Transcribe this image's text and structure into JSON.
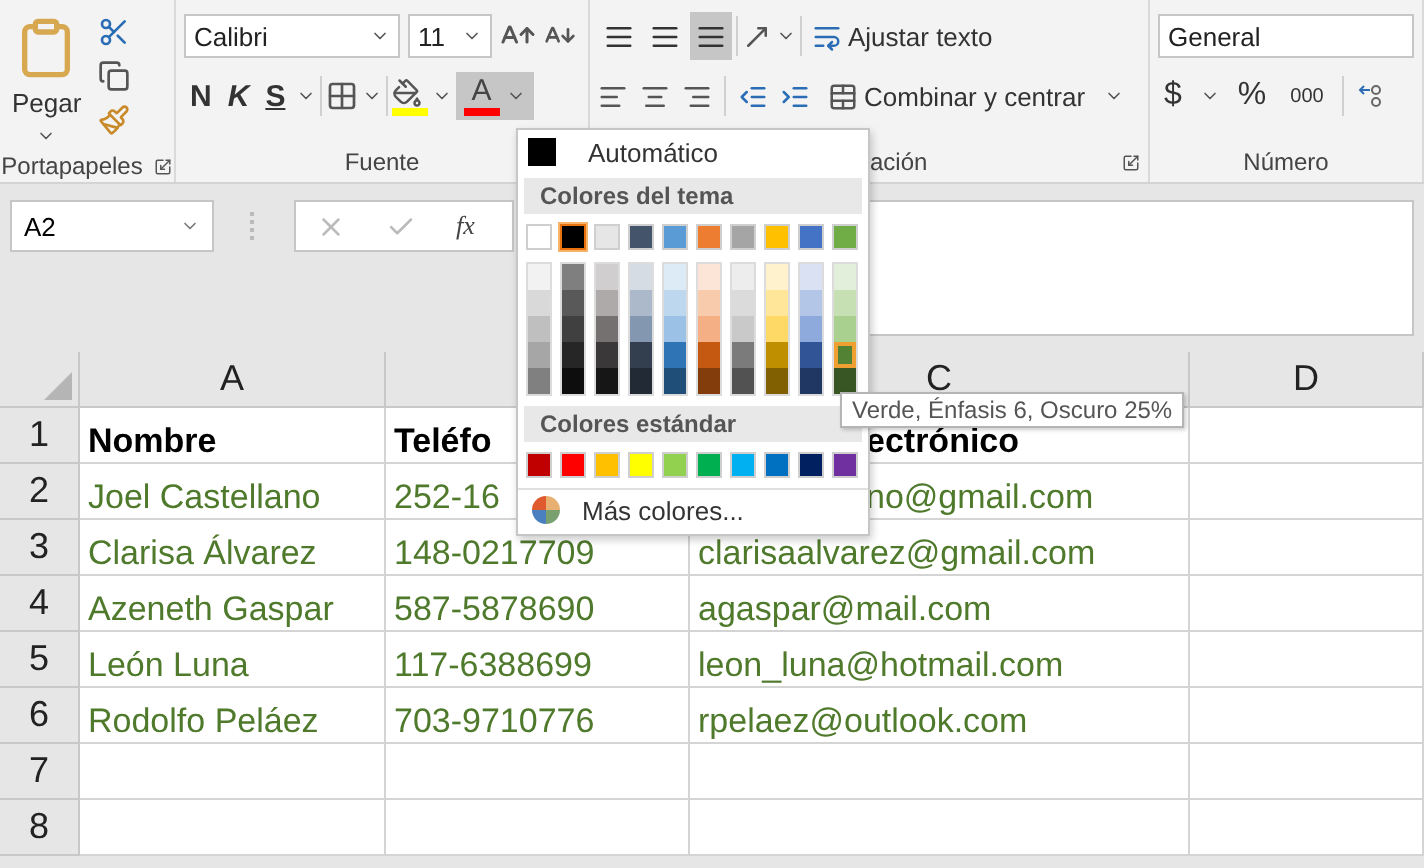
{
  "ribbon": {
    "clipboard": {
      "paste": "Pegar",
      "label": "Portapapeles"
    },
    "font": {
      "name": "Calibri",
      "size": "11",
      "bold": "N",
      "italic": "K",
      "underline": "S",
      "font_color_letter": "A",
      "font_color_open": true,
      "label": "Fuente"
    },
    "alignment": {
      "vertical_align": [
        {
          "selected": false
        },
        {
          "selected": false
        },
        {
          "selected": true
        }
      ],
      "wrap": "Ajustar texto",
      "merge": "Combinar y centrar",
      "label": "ación"
    },
    "number": {
      "format": "General",
      "currency": "$",
      "percent": "%",
      "thousands": "000",
      "label": "Número"
    }
  },
  "formula_bar": {
    "name_box": "A2",
    "function_label": "fx"
  },
  "sheet": {
    "columns": [
      {
        "label": "A"
      },
      {},
      {
        "label": "C"
      },
      {
        "label": "D"
      }
    ],
    "rows": [
      {
        "number": "1",
        "kind": "header",
        "cells": [
          {
            "text": "Nombre"
          },
          {
            "text": "Teléfo"
          },
          {
            "text": "ectrónico",
            "clipped": true
          },
          {}
        ]
      },
      {
        "number": "2",
        "kind": "data",
        "cells": [
          {
            "text": "Joel Castellano"
          },
          {
            "text": "252-16"
          },
          {
            "text": "no@gmail.com",
            "clipped": true
          },
          {}
        ]
      },
      {
        "number": "3",
        "kind": "data",
        "cells": [
          {
            "text": "Clarisa Álvarez"
          },
          {
            "text": "148-0217709"
          },
          {
            "text": "clarisaalvarez@gmail.com"
          },
          {}
        ]
      },
      {
        "number": "4",
        "kind": "data",
        "cells": [
          {
            "text": "Azeneth Gaspar"
          },
          {
            "text": "587-5878690"
          },
          {
            "text": "agaspar@mail.com"
          },
          {}
        ]
      },
      {
        "number": "5",
        "kind": "data",
        "cells": [
          {
            "text": "León Luna"
          },
          {
            "text": "117-6388699"
          },
          {
            "text": "leon_luna@hotmail.com"
          },
          {}
        ]
      },
      {
        "number": "6",
        "kind": "data",
        "cells": [
          {
            "text": "Rodolfo Peláez"
          },
          {
            "text": "703-9710776"
          },
          {
            "text": "rpelaez@outlook.com"
          },
          {}
        ]
      },
      {
        "number": "7",
        "kind": "data",
        "cells": [
          {},
          {},
          {},
          {}
        ]
      },
      {
        "number": "8",
        "kind": "data",
        "cells": [
          {},
          {},
          {},
          {}
        ]
      }
    ]
  },
  "color_menu": {
    "automatic": "Automático",
    "theme_title": "Colores del tema",
    "theme_colors": [
      {
        "color": "#ffffff",
        "selected": false,
        "shades": [
          {
            "color": "#f2f2f2",
            "selected": false
          },
          {
            "color": "#d9d9d9",
            "selected": false
          },
          {
            "color": "#bfbfbf",
            "selected": false
          },
          {
            "color": "#a6a6a6",
            "selected": false
          },
          {
            "color": "#808080",
            "selected": false
          }
        ]
      },
      {
        "color": "#000000",
        "selected": true,
        "shades": [
          {
            "color": "#7f7f7f",
            "selected": false
          },
          {
            "color": "#595959",
            "selected": false
          },
          {
            "color": "#404040",
            "selected": false
          },
          {
            "color": "#262626",
            "selected": false
          },
          {
            "color": "#0d0d0d",
            "selected": false
          }
        ]
      },
      {
        "color": "#e7e6e6",
        "selected": false,
        "shades": [
          {
            "color": "#d0cece",
            "selected": false
          },
          {
            "color": "#aeaaaa",
            "selected": false
          },
          {
            "color": "#757171",
            "selected": false
          },
          {
            "color": "#3a3838",
            "selected": false
          },
          {
            "color": "#171616",
            "selected": false
          }
        ]
      },
      {
        "color": "#44546a",
        "selected": false,
        "shades": [
          {
            "color": "#d6dce4",
            "selected": false
          },
          {
            "color": "#acb9ca",
            "selected": false
          },
          {
            "color": "#8497b0",
            "selected": false
          },
          {
            "color": "#333f4f",
            "selected": false
          },
          {
            "color": "#222b35",
            "selected": false
          }
        ]
      },
      {
        "color": "#5b9bd5",
        "selected": false,
        "shades": [
          {
            "color": "#ddebf7",
            "selected": false
          },
          {
            "color": "#bdd7ee",
            "selected": false
          },
          {
            "color": "#9bc2e6",
            "selected": false
          },
          {
            "color": "#2f75b5",
            "selected": false
          },
          {
            "color": "#1f4e78",
            "selected": false
          }
        ]
      },
      {
        "color": "#ed7d31",
        "selected": false,
        "shades": [
          {
            "color": "#fce4d6",
            "selected": false
          },
          {
            "color": "#f8cbad",
            "selected": false
          },
          {
            "color": "#f4b084",
            "selected": false
          },
          {
            "color": "#c65911",
            "selected": false
          },
          {
            "color": "#833c0c",
            "selected": false
          }
        ]
      },
      {
        "color": "#a5a5a5",
        "selected": false,
        "shades": [
          {
            "color": "#ededed",
            "selected": false
          },
          {
            "color": "#dbdbdb",
            "selected": false
          },
          {
            "color": "#c9c9c9",
            "selected": false
          },
          {
            "color": "#7b7b7b",
            "selected": false
          },
          {
            "color": "#525252",
            "selected": false
          }
        ]
      },
      {
        "color": "#ffc000",
        "selected": false,
        "shades": [
          {
            "color": "#fff2cc",
            "selected": false
          },
          {
            "color": "#ffe699",
            "selected": false
          },
          {
            "color": "#ffd966",
            "selected": false
          },
          {
            "color": "#bf8f00",
            "selected": false
          },
          {
            "color": "#806000",
            "selected": false
          }
        ]
      },
      {
        "color": "#4472c4",
        "selected": false,
        "shades": [
          {
            "color": "#d9e1f2",
            "selected": false
          },
          {
            "color": "#b4c6e7",
            "selected": false
          },
          {
            "color": "#8ea9db",
            "selected": false
          },
          {
            "color": "#305496",
            "selected": false
          },
          {
            "color": "#203764",
            "selected": false
          }
        ]
      },
      {
        "color": "#70ad47",
        "selected": false,
        "shades": [
          {
            "color": "#e2efda",
            "selected": false
          },
          {
            "color": "#c6e0b4",
            "selected": false
          },
          {
            "color": "#a9d08e",
            "selected": false
          },
          {
            "color": "#548235",
            "selected": true
          },
          {
            "color": "#375623",
            "selected": false
          }
        ]
      }
    ],
    "standard_title": "Colores estándar",
    "standard_colors": [
      {
        "color": "#c00000"
      },
      {
        "color": "#ff0000"
      },
      {
        "color": "#ffc000"
      },
      {
        "color": "#ffff00"
      },
      {
        "color": "#92d050"
      },
      {
        "color": "#00b050"
      },
      {
        "color": "#00b0f0"
      },
      {
        "color": "#0070c0"
      },
      {
        "color": "#002060"
      },
      {
        "color": "#7030a0"
      }
    ],
    "more": "Más colores..."
  },
  "tooltip": "Verde, Énfasis 6, Oscuro 25%"
}
